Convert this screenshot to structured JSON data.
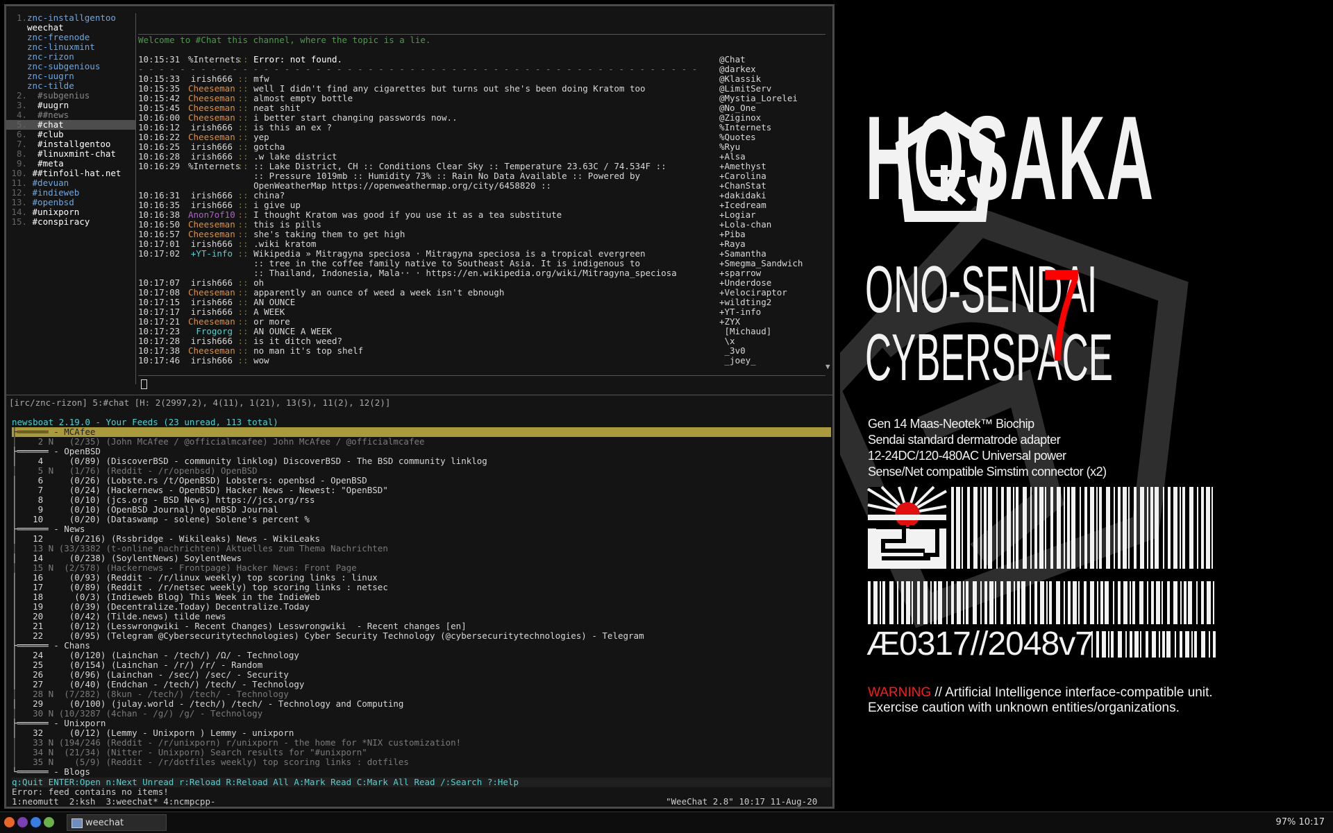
{
  "weechat": {
    "buflist": [
      {
        "num": "1.",
        "name": "znc-installgentoo",
        "color": "#6aa8e8"
      },
      {
        "num": "",
        "name": "weechat",
        "color": "#ffffff"
      },
      {
        "num": "",
        "name": "znc-freenode",
        "color": "#6aa8e8"
      },
      {
        "num": "",
        "name": "znc-linuxmint",
        "color": "#6aa8e8"
      },
      {
        "num": "",
        "name": "znc-rizon",
        "color": "#6aa8e8"
      },
      {
        "num": "",
        "name": "znc-subgenious",
        "color": "#6aa8e8"
      },
      {
        "num": "",
        "name": "znc-uugrn",
        "color": "#6aa8e8"
      },
      {
        "num": "",
        "name": "znc-tilde",
        "color": "#6aa8e8"
      },
      {
        "num": "2.",
        "name": "  #subgenius",
        "color": "#888888"
      },
      {
        "num": "3.",
        "name": "  #uugrn",
        "color": "#ffffff"
      },
      {
        "num": "4.",
        "name": "  ##news",
        "color": "#888888"
      },
      {
        "num": "5.",
        "name": "  #chat",
        "color": "#ffffff",
        "selected": true
      },
      {
        "num": "6.",
        "name": "  #club",
        "color": "#ffffff"
      },
      {
        "num": "7.",
        "name": "  #installgentoo",
        "color": "#ffffff"
      },
      {
        "num": "8.",
        "name": "  #linuxmint-chat",
        "color": "#ffffff"
      },
      {
        "num": "9.",
        "name": "  #meta",
        "color": "#ffffff"
      },
      {
        "num": "10.",
        "name": " ##tinfoil-hat.net",
        "color": "#ffffff"
      },
      {
        "num": "11.",
        "name": " #devuan",
        "color": "#6aa8e8"
      },
      {
        "num": "12.",
        "name": " #indieweb",
        "color": "#6aa8e8"
      },
      {
        "num": "13.",
        "name": " #openbsd",
        "color": "#6aa8e8"
      },
      {
        "num": "14.",
        "name": " #unixporn",
        "color": "#ffffff"
      },
      {
        "num": "15.",
        "name": " #conspiracy",
        "color": "#ffffff"
      }
    ],
    "topic": "Welcome to #Chat this channel, where the topic is a lie.",
    "messages": [
      {
        "time": "10:15:31",
        "nick": "%Internets",
        "nickColor": "#d8d8d8",
        "text": "Error: not found.",
        "boldPrefix": "Error:"
      },
      {
        "time": "",
        "nick": "",
        "nickColor": "#777",
        "text": "",
        "dash": true
      },
      {
        "time": "10:15:33",
        "nick": "irish666",
        "nickColor": "#d8d8d8",
        "text": "mfw"
      },
      {
        "time": "10:15:35",
        "nick": "Cheeseman",
        "nickColor": "#e0903a",
        "text": "well I didn't find any cigarettes but turns out she's been doing Kratom too"
      },
      {
        "time": "10:15:42",
        "nick": "Cheeseman",
        "nickColor": "#e0903a",
        "text": "almost empty bottle"
      },
      {
        "time": "10:15:45",
        "nick": "Cheeseman",
        "nickColor": "#e0903a",
        "text": "neat shit"
      },
      {
        "time": "10:16:00",
        "nick": "Cheeseman",
        "nickColor": "#e0903a",
        "text": "i better start changing passwords now.."
      },
      {
        "time": "10:16:12",
        "nick": "irish666",
        "nickColor": "#d8d8d8",
        "text": "is this an ex ?"
      },
      {
        "time": "10:16:22",
        "nick": "Cheeseman",
        "nickColor": "#e0903a",
        "text": "yep"
      },
      {
        "time": "10:16:25",
        "nick": "irish666",
        "nickColor": "#d8d8d8",
        "text": "gotcha"
      },
      {
        "time": "10:16:28",
        "nick": "irish666",
        "nickColor": "#d8d8d8",
        "text": ".w lake district"
      },
      {
        "time": "10:16:29",
        "nick": "%Internets",
        "nickColor": "#d8d8d8",
        "text": ":: Lake District, CH :: Conditions Clear Sky :: Temperature 23.63C / 74.534F ::"
      },
      {
        "time": "",
        "nick": "",
        "nickColor": "#d8d8d8",
        "text": ":: Pressure 1019mb :: Humidity 73% :: Rain No Data Available :: Powered by"
      },
      {
        "time": "",
        "nick": "",
        "nickColor": "#d8d8d8",
        "text": "OpenWeatherMap https://openweathermap.org/city/6458820 ::"
      },
      {
        "time": "10:16:31",
        "nick": "irish666",
        "nickColor": "#d8d8d8",
        "text": "china?"
      },
      {
        "time": "10:16:35",
        "nick": "irish666",
        "nickColor": "#d8d8d8",
        "text": "i give up"
      },
      {
        "time": "10:16:38",
        "nick": "Anon7of10",
        "nickColor": "#b060c8",
        "text": "I thought Kratom was good if you use it as a tea substitute"
      },
      {
        "time": "10:16:50",
        "nick": "Cheeseman",
        "nickColor": "#e0903a",
        "text": "this is pills"
      },
      {
        "time": "10:16:57",
        "nick": "Cheeseman",
        "nickColor": "#e0903a",
        "text": "she's taking them to get high"
      },
      {
        "time": "10:17:01",
        "nick": "irish666",
        "nickColor": "#d8d8d8",
        "text": ".wiki kratom"
      },
      {
        "time": "10:17:02",
        "nick": "+YT-info",
        "nickColor": "#4fd3d3",
        "text": "Wikipedia » Mitragyna speciosa · Mitragyna speciosa is a tropical evergreen"
      },
      {
        "time": "",
        "nick": "",
        "nickColor": "#d8d8d8",
        "text": ":: tree in the coffee family native to Southeast Asia. It is indigenous to"
      },
      {
        "time": "",
        "nick": "",
        "nickColor": "#d8d8d8",
        "text": ":: Thailand, Indonesia, Mala·· · https://en.wikipedia.org/wiki/Mitragyna_speciosa"
      },
      {
        "time": "10:17:07",
        "nick": "irish666",
        "nickColor": "#d8d8d8",
        "text": "oh"
      },
      {
        "time": "10:17:08",
        "nick": "Cheeseman",
        "nickColor": "#e0903a",
        "text": "apparently an ounce of weed a week isn't ebnough"
      },
      {
        "time": "10:17:15",
        "nick": "irish666",
        "nickColor": "#d8d8d8",
        "text": "AN OUNCE"
      },
      {
        "time": "10:17:17",
        "nick": "irish666",
        "nickColor": "#d8d8d8",
        "text": "A WEEK"
      },
      {
        "time": "10:17:21",
        "nick": "Cheeseman",
        "nickColor": "#e0903a",
        "text": "or more"
      },
      {
        "time": "10:17:23",
        "nick": "Frogorg",
        "nickColor": "#4fd3d3",
        "text": "AN OUNCE A WEEK"
      },
      {
        "time": "10:17:28",
        "nick": "irish666",
        "nickColor": "#d8d8d8",
        "text": "is it ditch weed?"
      },
      {
        "time": "10:17:38",
        "nick": "Cheeseman",
        "nickColor": "#e0903a",
        "text": "no man it's top shelf"
      },
      {
        "time": "10:17:46",
        "nick": "irish666",
        "nickColor": "#d8d8d8",
        "text": "wow"
      }
    ],
    "nicks": [
      "@Chat",
      "@darkex",
      "@Klassik",
      "@LimitServ",
      "@Mystia_Lorelei",
      "@No_One",
      "@Ziginox",
      "%Internets",
      "%Quotes",
      "%Ryu",
      "+Alsa",
      "+Amethyst",
      "+Carolina",
      "+ChanStat",
      "+dakidaki",
      "+Icedream",
      "+Logiar",
      "+Lola-chan",
      "+Piba",
      "+Raya",
      "+Samantha",
      "+Smegma_Sandwich",
      "+sparrow",
      "+Underdose",
      "+Velociraptor",
      "+wildting2",
      "+YT-info",
      "+ZYX",
      " [Michaud]",
      " \\x",
      " _3v0",
      " _joey_"
    ],
    "arrow": "▼",
    "status": "[irc/znc-rizon] 5:#chat [H: 2(2997,2), 4(11), 1(21), 13(5), 11(2), 12(2)]"
  },
  "newsboat": {
    "title": "newsboat 2.19.0 - Your Feeds (23 unread, 113 total)",
    "lines": [
      {
        "t": "├══════ - MCAfee",
        "hl": true
      },
      {
        "t": "│    2 N   (2/35) (John McAfee / @officialmcafee) John McAfee / @officialmcafee",
        "gray": true
      },
      {
        "t": "├══════ - OpenBSD"
      },
      {
        "t": "│    4     (0/89) (DiscoverBSD - community linklog) DiscoverBSD - The BSD community linklog"
      },
      {
        "t": "│    5 N   (1/76) (Reddit - /r/openbsd) OpenBSD",
        "gray": true
      },
      {
        "t": "│    6     (0/26) (Lobste.rs /t/OpenBSD) Lobsters: openbsd - OpenBSD"
      },
      {
        "t": "│    7     (0/24) (Hackernews - OpenBSD) Hacker News - Newest: \"OpenBSD\""
      },
      {
        "t": "│    8     (0/10) (jcs.org - BSD News) https://jcs.org/rss"
      },
      {
        "t": "│    9     (0/10) (OpenBSD Journal) OpenBSD Journal"
      },
      {
        "t": "│   10     (0/20) (Dataswamp - solene) Solene's percent %"
      },
      {
        "t": "├══════ - News"
      },
      {
        "t": "│   12     (0/216) (Rssbridge - Wikileaks) News - WikiLeaks"
      },
      {
        "t": "│   13 N (33/3382 (t-online nachrichten) Aktuelles zum Thema Nachrichten",
        "gray": true
      },
      {
        "t": "│   14     (0/238) (SoylentNews) SoylentNews"
      },
      {
        "t": "│   15 N  (2/578) (Hackernews - Frontpage) Hacker News: Front Page",
        "gray": true
      },
      {
        "t": "│   16     (0/93) (Reddit - /r/linux weekly) top scoring links : linux"
      },
      {
        "t": "│   17     (0/89) (Reddit . /r/netsec weekly) top scoring links : netsec"
      },
      {
        "t": "│   18      (0/3) (Indieweb Blog) This Week in the IndieWeb"
      },
      {
        "t": "│   19     (0/39) (Decentralize.Today) Decentralize.Today"
      },
      {
        "t": "│   20     (0/42) (Tilde.news) tilde news"
      },
      {
        "t": "│   21     (0/12) (Lesswrongwiki - Recent Changes) Lesswrongwiki  - Recent changes [en]"
      },
      {
        "t": "│   22     (0/95) (Telegram @Cybersecuritytechnologies) Cyber Security Technology (@cybersecuritytechnologies) - Telegram"
      },
      {
        "t": "├══════ - Chans"
      },
      {
        "t": "│   24     (0/120) (Lainchan - /tech/) /Ω/ - Technology"
      },
      {
        "t": "│   25     (0/154) (Lainchan - /r/) /r/ - Random"
      },
      {
        "t": "│   26     (0/96) (Lainchan - /sec/) /sec/ - Security"
      },
      {
        "t": "│   27     (0/40) (Endchan - /tech/) /tech/ - Technology"
      },
      {
        "t": "│   28 N  (7/282) (8kun - /tech/) /tech/ - Technology",
        "gray": true
      },
      {
        "t": "│   29     (0/100) (julay.world - /tech/) /tech/ - Technology and Computing"
      },
      {
        "t": "│   30 N (10/3287 (4chan - /g/) /g/ - Technology",
        "gray": true
      },
      {
        "t": "├══════ - Unixporn"
      },
      {
        "t": "│   32     (0/12) (Lemmy - Unixporn ) Lemmy - unixporn"
      },
      {
        "t": "│   33 N (194/246 (Reddit - /r/unixporn) r/unixporn - the home for *NIX customization!",
        "gray": true
      },
      {
        "t": "│   34 N  (21/34) (Nitter - Unixporn) Search results for \"#unixporn\"",
        "gray": true
      },
      {
        "t": "│   35 N    (5/9) (Reddit - /r/dotfiles weekly) top scoring links : dotfiles",
        "gray": true
      },
      {
        "t": "└══════ - Blogs"
      }
    ],
    "help": "q:Quit ENTER:Open n:Next Unread r:Reload R:Reload All A:Mark Read C:Mark All Read /:Search ?:Help",
    "error": "Error: feed contains no items!",
    "tmux_left": "1:neomutt  2:ksh  3:weechat* 4:ncmpcpp-",
    "tmux_right": "\"WeeChat 2.8\" 10:17 11-Aug-20"
  },
  "poster": {
    "title": "HOSAKA",
    "line1": "ONO-SENDAI",
    "line2": "CYBERSPACE",
    "seven": "7",
    "specs": [
      "Gen 14 Maas-Neotek™ Biochip",
      "Sendai standard dermatrode adapter",
      "12-24DC/120-480AC Universal power",
      "Sense/Net compatible Simstim connector (x2)"
    ],
    "serial": "Æ0317//2048v7",
    "warning_label": "WARNING",
    "warning_text": " // Artificial Intelligence interface-compatible unit.",
    "warning_text2": "Exercise caution with unknown entities/organizations.",
    "accent": "#ff0000"
  },
  "taskbar": {
    "window_label": "weechat",
    "clock": "97% 10:17"
  }
}
